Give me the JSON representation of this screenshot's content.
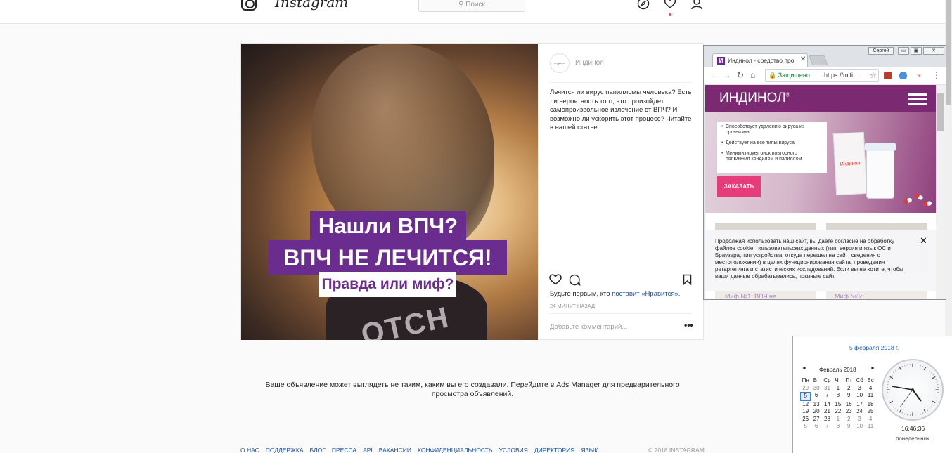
{
  "header": {
    "wordmark": "Instagram",
    "search_placeholder": "Поиск"
  },
  "post": {
    "image_lines": [
      "Нашли ВПЧ?",
      "ВПЧ НЕ ЛЕЧИТСЯ!",
      "Правда или миф?"
    ],
    "shirt_text": "OTCH",
    "avatar_text": "индинол",
    "username": "Индинол",
    "caption": "Лечится ли вирус папилломы человека? Есть ли вероятность того, что произойдет самопроизвольное излечение от ВПЧ? И возможно ли ускорить этот процесс? Читайте в нашей статье.",
    "likes_prefix": "Будьте первым, кто ",
    "likes_link": "поставит «Нравится».",
    "time": "24 МИНУТ НАЗАД",
    "comment_placeholder": "Добавьте комментарий...",
    "more": "•••"
  },
  "notice": "Ваше объявление может выглядеть не таким, каким вы его создавали. Перейдите в Ads Manager для предварительного просмотра объявлений.",
  "footer": {
    "links": [
      "О НАС",
      "ПОДДЕРЖКА",
      "БЛОГ",
      "ПРЕССА",
      "API",
      "ВАКАНСИИ",
      "КОНФИДЕНЦИАЛЬНОСТЬ",
      "УСЛОВИЯ",
      "ДИРЕКТОРИЯ",
      "ЯЗЫК"
    ],
    "copyright": "© 2018 INSTAGRAM"
  },
  "browser": {
    "profile": "Сергей",
    "tab_title": "Индинол - средство про",
    "tab_favicon": "И",
    "tab_close": "✕",
    "secure_label": "🔒 Защищено",
    "url": "https://mifi...",
    "window_controls": [
      "▭",
      "▣",
      "✕"
    ],
    "site": {
      "logo": "ИНДИНОЛ",
      "logo_mark": "®",
      "bullets": [
        "Способствует удалению вируса из организма",
        "Действует на все типы вируса",
        "Минимизирует риск повторного появления кондилом и папиллом"
      ],
      "order_button": "ЗАКАЗАТЬ",
      "box_label": "Индинол",
      "cookie_text": "Продолжая использовать наш сайт, вы даете согласие на обработку файлов cookie, пользовательских данных (тип, версия и язык ОС и Браузера; тип устройства; откуда перешел на сайт; сведения о местоположении) в целях функционирования сайта, проведения ретаргетинга и статистических исследований. Если вы не хотите, чтобы ваши данные обрабатывались, покиньте сайт.",
      "cookie_close": "✕",
      "card_titles": [
        "Миф №1: ВПЧ не",
        "Миф №5:"
      ]
    }
  },
  "calendar": {
    "date_long": "5 февраля 2018 г.",
    "month": "Февраль 2018",
    "prev": "◄",
    "next": "►",
    "weekdays": [
      "Пн",
      "Вт",
      "Ср",
      "Чт",
      "Пт",
      "Сб",
      "Вс"
    ],
    "weeks": [
      [
        "29",
        "30",
        "31",
        "1",
        "2",
        "3",
        "4"
      ],
      [
        "5",
        "6",
        "7",
        "8",
        "9",
        "10",
        "11"
      ],
      [
        "12",
        "13",
        "14",
        "15",
        "16",
        "17",
        "18"
      ],
      [
        "19",
        "20",
        "21",
        "22",
        "23",
        "24",
        "25"
      ],
      [
        "26",
        "27",
        "28",
        "1",
        "2",
        "3",
        "4"
      ],
      [
        "5",
        "6",
        "7",
        "8",
        "9",
        "10",
        "11"
      ]
    ],
    "today": "5",
    "time": "16:46:36",
    "weekday_name": "понедельник"
  },
  "colors": {
    "brand_purple": "#6a2d8f",
    "site_header": "#7b2a72",
    "order_pink": "#e63d7a",
    "link_blue": "#1d4f91"
  },
  "icons": [
    "instagram-logo-icon",
    "compass-icon",
    "heart-icon",
    "profile-icon",
    "comment-icon",
    "bookmark-icon",
    "back-icon",
    "forward-icon",
    "reload-icon",
    "home-icon",
    "star-icon",
    "menu-icon"
  ]
}
